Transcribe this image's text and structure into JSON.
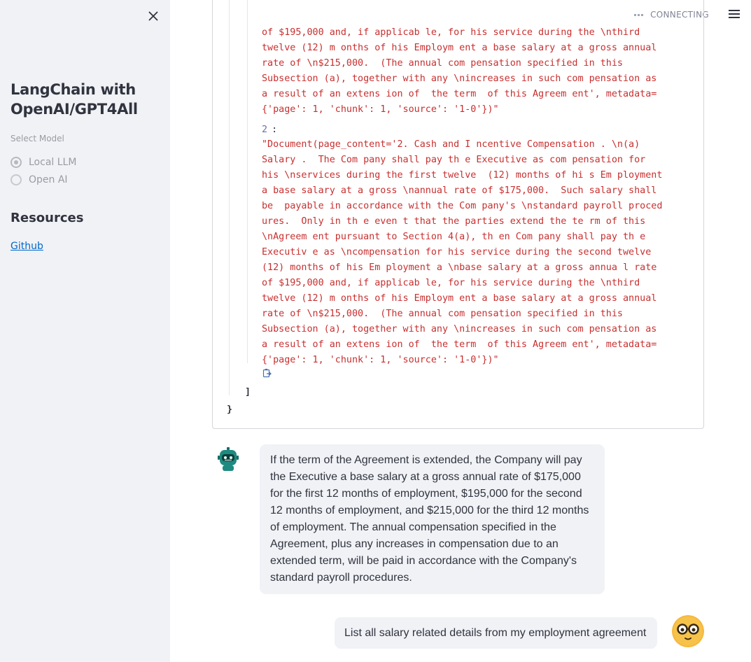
{
  "sidebar": {
    "title": "LangChain with OpenAI/GPT4All",
    "select_label": "Select Model",
    "options": [
      {
        "label": "Local LLM",
        "selected": true
      },
      {
        "label": "Open AI",
        "selected": false
      }
    ],
    "resources_heading": "Resources",
    "link_label": "Github"
  },
  "header": {
    "status": "CONNECTING"
  },
  "json_view": {
    "chunk1_tail": "of $195,000 and, if applicab le, for his service during the \\nthird\ntwelve (12) m onths of his Employm ent a base salary at a gross annual\nrate of \\n$215,000.  (The annual com pensation specified in this\nSubsection (a), together with any \\nincreases in such com pensation as\na result of an extens ion of  the term  of this Agreem ent', metadata=\n{'page': 1, 'chunk': 1, 'source': '1-0'})\"",
    "index_label": "2",
    "index_colon": ":",
    "chunk2": "\"Document(page_content='2. Cash and I ncentive Compensation . \\n(a)\nSalary .  The Com pany shall pay th e Executive as com pensation for\nhis \\nservices during the first twelve  (12) months of hi s Em ployment\na base salary at a gross \\nannual rate of $175,000.  Such salary shall\nbe  payable in accordance with the Com pany's \\nstandard payroll proced\nures.  Only in th e even t that the parties extend the te rm of this\n\\nAgreem ent pursuant to Section 4(a), th en Com pany shall pay th e\nExecutiv e as \\ncompensation for his service during the second twelve\n(12) months of his Em ployment a \\nbase salary at a gross annua l rate\nof $195,000 and, if applicab le, for his service during the \\nthird\ntwelve (12) m onths of his Employm ent a base salary at a gross annual\nrate of \\n$215,000.  (The annual com pensation specified in this\nSubsection (a), together with any \\nincreases in such com pensation as\na result of an extens ion of  the term  of this Agreem ent', metadata=\n{'page': 1, 'chunk': 1, 'source': '1-0'})\"",
    "close_bracket": "]",
    "close_brace": "}"
  },
  "chat": {
    "assistant_message": "If the term of the Agreement is extended, the Company will pay the Executive a base salary at a gross annual rate of $175,000 for the first 12 months of employment, $195,000 for the second 12 months of employment, and $215,000 for the third 12 months of employment. The annual compensation specified in the Agreement, plus any increases in compensation due to an extended term, will be paid in accordance with the Company's standard payroll procedures.",
    "user_message": "List all salary related details from my employment agreement"
  },
  "icons": [
    "close-icon",
    "hamburger-menu-icon",
    "copy-icon",
    "bot-avatar-icon",
    "user-avatar-icon"
  ]
}
